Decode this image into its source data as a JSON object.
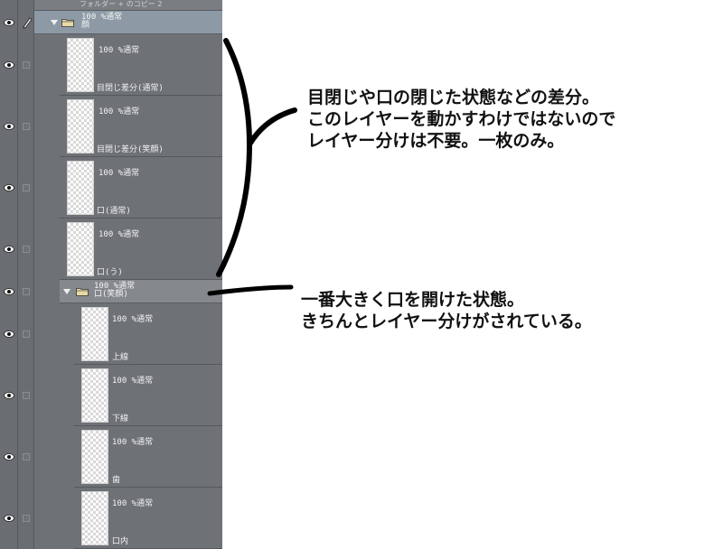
{
  "panel": {
    "top_strip_text": "フォルダー  + のコピー 2",
    "folders": [
      {
        "id": "kao",
        "mode": "100 %通常",
        "name": "顔",
        "selected": true
      },
      {
        "id": "kuchi_egao",
        "mode": "100 %通常",
        "name": "口(笑顔)",
        "selected": false
      }
    ],
    "layers": [
      {
        "mode": "100 %通常",
        "name": "目閉じ差分(通常)"
      },
      {
        "mode": "100 %通常",
        "name": "目閉じ差分(笑顔)"
      },
      {
        "mode": "100 %通常",
        "name": "口(通常)"
      },
      {
        "mode": "100 %通常",
        "name": "口(う)"
      },
      {
        "mode": "100 %通常",
        "name": "上線"
      },
      {
        "mode": "100 %通常",
        "name": "下線"
      },
      {
        "mode": "100 %通常",
        "name": "歯"
      },
      {
        "mode": "100 %通常",
        "name": "口内"
      }
    ]
  },
  "annotations": {
    "note1": [
      "目閉じや口の閉じた状態などの差分。",
      "このレイヤーを動かすわけではないので",
      "レイヤー分けは不要。一枚のみ。"
    ],
    "note2": [
      "一番大きく口を開けた状態。",
      "きちんとレイヤー分けがされている。"
    ]
  },
  "colors": {
    "panel_bg": "#6e7277",
    "folder_band": "#85898e",
    "selected_band": "#8d9aa6",
    "annotation_ink": "#111111"
  }
}
